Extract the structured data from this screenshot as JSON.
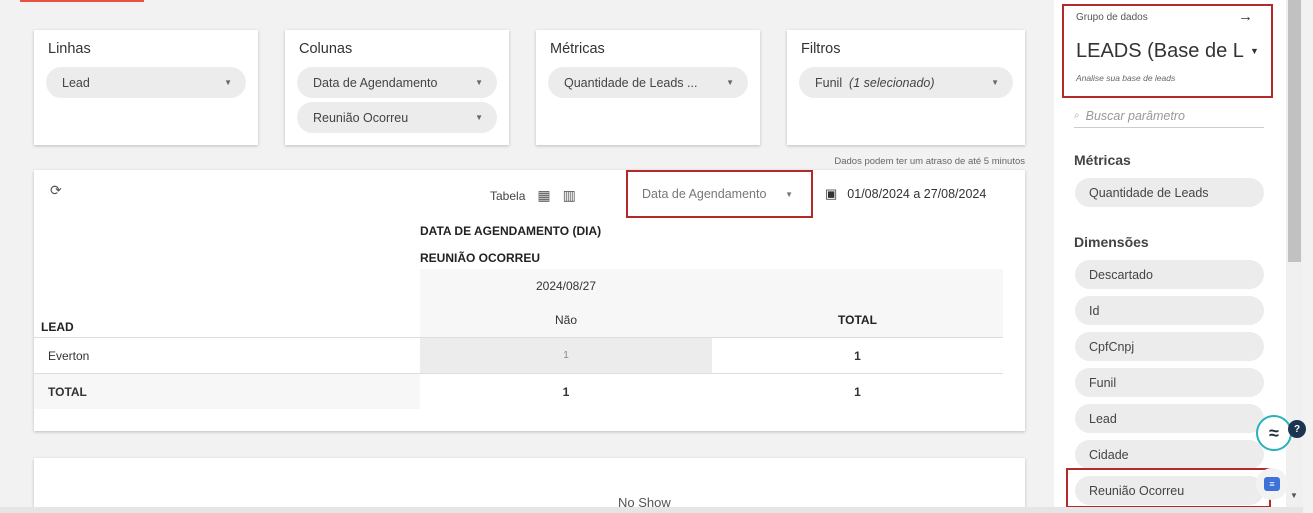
{
  "config": {
    "linhas": {
      "title": "Linhas",
      "value": "Lead"
    },
    "colunas": {
      "title": "Colunas",
      "values": [
        "Data de Agendamento",
        "Reunião Ocorreu"
      ]
    },
    "metricas": {
      "title": "Métricas",
      "value": "Quantidade de Leads ..."
    },
    "filtros": {
      "title": "Filtros",
      "value": "Funil",
      "detail": "(1 selecionado)"
    }
  },
  "delay_note": "Dados podem ter um atraso de até 5 minutos",
  "toolbar": {
    "view_label": "Tabela",
    "date_field": "Data de Agendamento",
    "date_range": "01/08/2024 a 27/08/2024"
  },
  "pivot": {
    "col_header_1": "DATA DE AGENDAMENTO (DIA)",
    "col_header_2": "REUNIÃO OCORREU",
    "date": "2024/08/27",
    "row_header": "LEAD",
    "sub_col": "Não",
    "total_col": "TOTAL",
    "rows": [
      {
        "label": "Everton",
        "value": "1",
        "total": "1"
      },
      {
        "label": "TOTAL",
        "value": "1",
        "total": "1"
      }
    ]
  },
  "second_card": {
    "label": "No Show"
  },
  "sidebar": {
    "group_label": "Grupo de dados",
    "group_title": "LEADS (Base de L",
    "group_sub": "Analise sua base de leads",
    "search_placeholder": "Buscar parâmetro",
    "metricas_title": "Métricas",
    "metricas": [
      "Quantidade de Leads"
    ],
    "dimensoes_title": "Dimensões",
    "dimensoes": [
      "Descartado",
      "Id",
      "CpfCnpj",
      "Funil",
      "Lead",
      "Cidade",
      "Reunião Ocorreu"
    ]
  },
  "widgets": {
    "help_badge": "?"
  },
  "colors": {
    "accent": "#e8533f",
    "highlight": "#b22a2a",
    "teal": "#27b2b8"
  }
}
